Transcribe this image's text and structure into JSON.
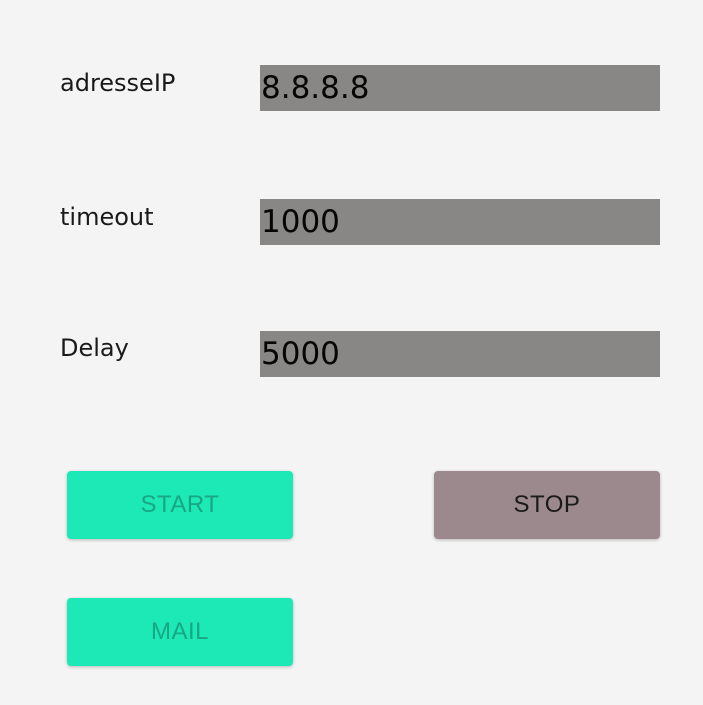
{
  "form": {
    "ip_label": "adresseIP",
    "ip_value": "8.8.8.8",
    "timeout_label": "timeout",
    "timeout_value": "1000",
    "delay_label": "Delay",
    "delay_value": "5000"
  },
  "buttons": {
    "start_label": "START",
    "stop_label": "STOP",
    "mail_label": "MAIL"
  },
  "colors": {
    "background": "#f4f4f4",
    "field_background": "#888785",
    "accent_green": "#1de9b6",
    "accent_green_text": "#18a684",
    "stop_background": "#9c898d"
  }
}
